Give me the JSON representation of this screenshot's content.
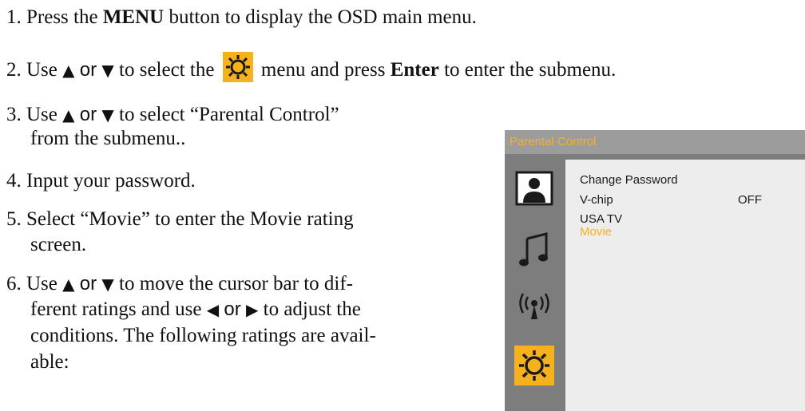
{
  "steps": [
    {
      "num": "1.",
      "a": "Press the ",
      "bold": "MENU",
      "b": " button to display the OSD main menu."
    },
    {
      "num": "2.",
      "a": "Use ",
      "up": "▲",
      "or": "or",
      "down": "▼",
      "b": " to select the ",
      "c": " menu and press ",
      "bold": "Enter",
      "d": " to enter the submenu."
    },
    {
      "num": "3.",
      "a": "Use ",
      "up": "▲",
      "or": "or",
      "down": "▼",
      "b": " to select  “Parental Control”",
      "cont": "from the submenu.."
    },
    {
      "num": "4.",
      "a": "Input your password."
    },
    {
      "num": "5.",
      "a": "Select “Movie” to enter the Movie rating",
      "cont": "screen."
    },
    {
      "num": "6.",
      "a": "Use ",
      "up": "▲",
      "or": "or",
      "down": "▼",
      "b": " to move the cursor bar to dif-",
      "line2a": "ferent ratings and use ",
      "left": "◀",
      "or2": "or",
      "right": "▶",
      "line2b": " to adjust the",
      "line3": "conditions. The following ratings are avail-",
      "line4": "able:"
    }
  ],
  "osd": {
    "title": "Parental Control",
    "items": [
      {
        "label": "Change Password",
        "value": ""
      },
      {
        "label": "V-chip",
        "value": "OFF"
      },
      {
        "label": "USA TV",
        "value": ""
      },
      {
        "label": "Movie",
        "value": ""
      }
    ],
    "icons": [
      "picture-icon",
      "music-icon",
      "antenna-icon",
      "settings-icon"
    ],
    "accent": "#f6b21c"
  }
}
